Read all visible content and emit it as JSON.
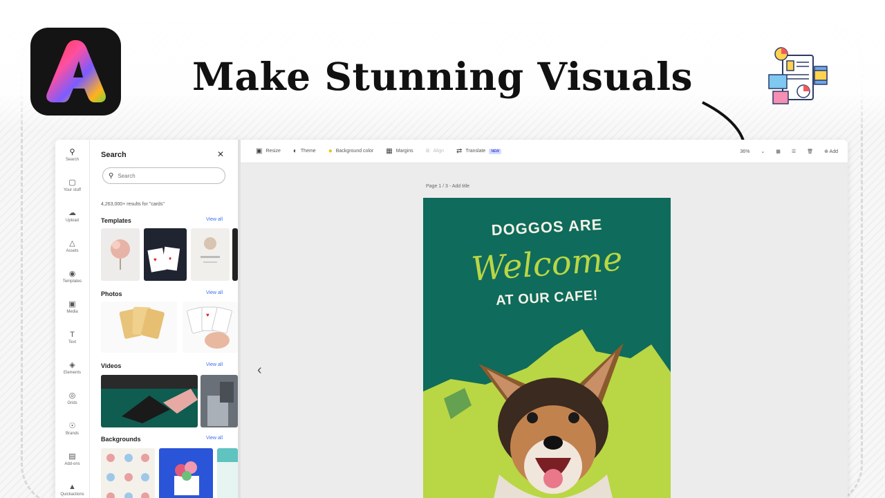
{
  "headline": "Make Stunning Visuals",
  "colors": {
    "accent_green": "#b9d644",
    "poster_teal": "#0f6b5b",
    "link_blue": "#3b6cf0"
  },
  "rail": {
    "items": [
      {
        "label": "Search",
        "icon": "search-icon"
      },
      {
        "label": "Your stuff",
        "icon": "folder-icon"
      },
      {
        "label": "Upload",
        "icon": "upload-icon"
      },
      {
        "label": "Assets",
        "icon": "assets-icon"
      },
      {
        "label": "Templates",
        "icon": "templates-icon"
      },
      {
        "label": "Media",
        "icon": "media-icon"
      },
      {
        "label": "Text",
        "icon": "text-icon"
      },
      {
        "label": "Elements",
        "icon": "elements-icon"
      },
      {
        "label": "Grids",
        "icon": "grid-icon"
      },
      {
        "label": "Brands",
        "icon": "brand-icon"
      },
      {
        "label": "Add-ons",
        "icon": "addons-icon"
      },
      {
        "label": "Quickactions",
        "icon": "quickactions-icon"
      }
    ]
  },
  "panel": {
    "title": "Search",
    "search_placeholder": "Search",
    "result_count": "4,263,000+ results for \"cards\"",
    "sections": {
      "templates": "Templates",
      "photos": "Photos",
      "videos": "Videos",
      "backgrounds": "Backgrounds"
    },
    "view_all": "View all"
  },
  "toolbar": {
    "resize": "Resize",
    "theme": "Theme",
    "background_color": "Background color",
    "margins": "Margins",
    "align": "Align",
    "translate": "Translate",
    "new_badge": "NEW",
    "zoom": "36%",
    "add": "Add"
  },
  "canvas": {
    "page_label": "Page 1 / 3 - Add title"
  },
  "poster": {
    "line1": "DOGGOS ARE",
    "script": "Welcome",
    "line3": "AT OUR CAFE!"
  }
}
